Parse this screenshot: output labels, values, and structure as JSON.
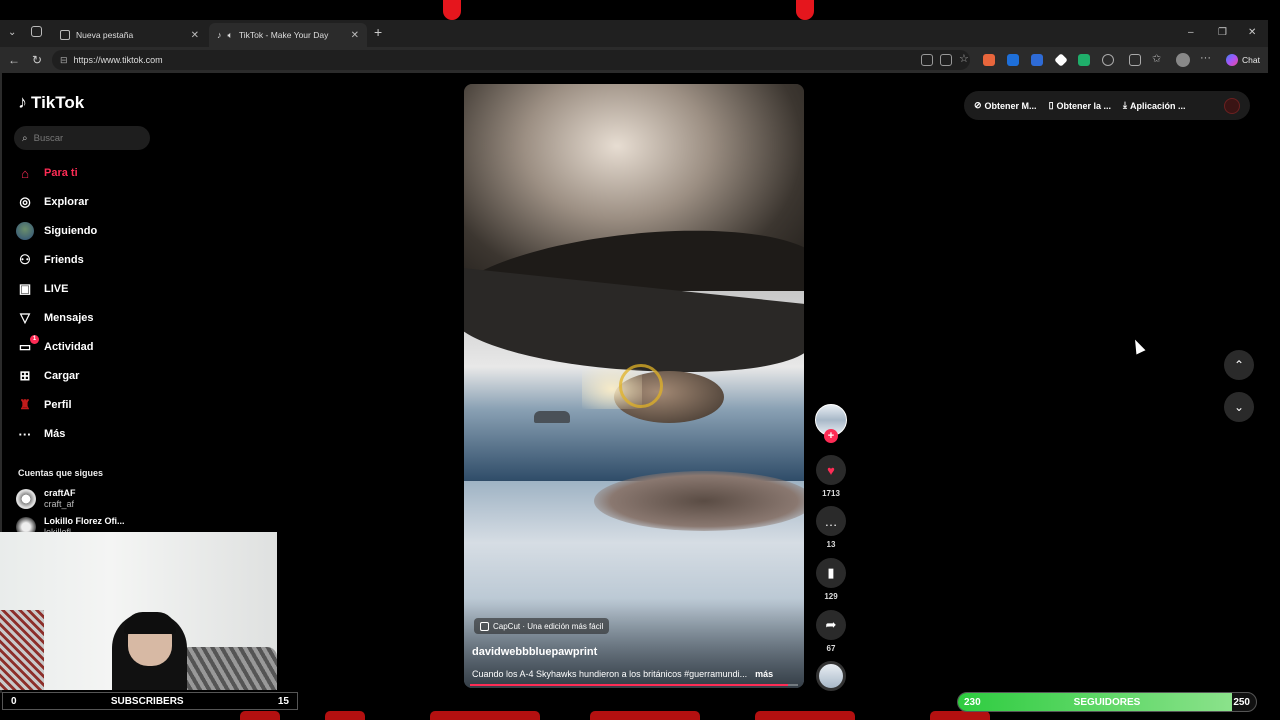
{
  "browser": {
    "tabs": [
      {
        "label": "Nueva pestaña",
        "icon": "page-icon"
      },
      {
        "label": "TikTok - Make Your Day",
        "icon": "tiktok-icon"
      }
    ],
    "url": "https://www.tiktok.com",
    "chat_label": "Chat"
  },
  "sidebar": {
    "logo": "TikTok",
    "search_placeholder": "Buscar",
    "nav": [
      {
        "label": "Para ti",
        "icon": "home-icon",
        "active": true
      },
      {
        "label": "Explorar",
        "icon": "compass-icon"
      },
      {
        "label": "Siguiendo",
        "icon": "following-avatar"
      },
      {
        "label": "Friends",
        "icon": "friends-icon"
      },
      {
        "label": "LIVE",
        "icon": "live-icon"
      },
      {
        "label": "Mensajes",
        "icon": "messages-icon"
      },
      {
        "label": "Actividad",
        "icon": "activity-icon",
        "badge": "1"
      },
      {
        "label": "Cargar",
        "icon": "upload-icon"
      },
      {
        "label": "Perfil",
        "icon": "profile-icon"
      },
      {
        "label": "Más",
        "icon": "more-icon"
      }
    ],
    "following_header": "Cuentas que sigues",
    "following": [
      {
        "name": "craftAF",
        "handle": "craft_af"
      },
      {
        "name": "Lokillo Florez Ofi...",
        "handle": "lokillofl..."
      }
    ]
  },
  "video": {
    "capcut_label": "CapCut · Una edición más fácil",
    "author": "davidwebbbluepawprint",
    "caption": "Cuando los A-4 Skyhawks hundieron a los británicos #guerramundi...",
    "more_label": "más",
    "progress": 0.97
  },
  "actions": {
    "likes": "1713",
    "comments": "13",
    "saves": "129",
    "shares": "67"
  },
  "top_pill": {
    "item1": "Obtener M...",
    "item2": "Obtener la ...",
    "item3": "Aplicación ..."
  },
  "stream": {
    "subs_left": "0",
    "subs_label": "SUBSCRIBERS",
    "subs_right": "15",
    "seg_left": "230",
    "seg_label": "SEGUIDORES",
    "seg_right": "250",
    "seg_progress": 0.92
  },
  "colors": {
    "accent": "#fe2c55",
    "stream_green": "#2ecc40",
    "stream_red": "#e5161d"
  }
}
